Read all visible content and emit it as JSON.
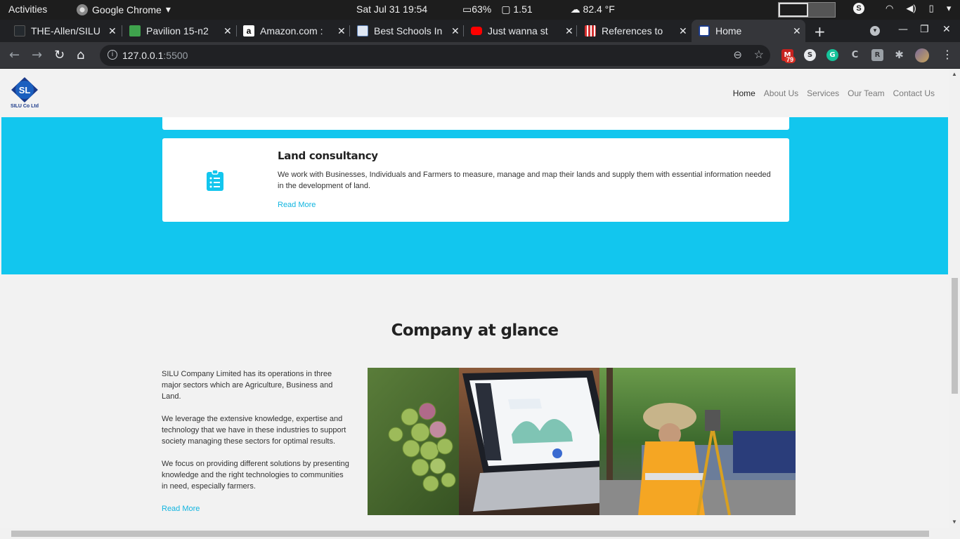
{
  "os_bar": {
    "activities": "Activities",
    "app_name": "Google Chrome",
    "clock": "Sat Jul 31  19:54",
    "battery": "63%",
    "load": "1.51",
    "weather": "82.4 °F"
  },
  "tabs": [
    {
      "title": "THE-Allen/SILU",
      "color": "#24292e",
      "active": false
    },
    {
      "title": "Pavilion 15-n2",
      "color": "#3fa34d",
      "active": false
    },
    {
      "title": "Amazon.com :",
      "color": "#f3a847",
      "active": false
    },
    {
      "title": "Best Schools In",
      "color": "#5b7fb5",
      "active": false
    },
    {
      "title": "Just wanna st",
      "color": "#ff0000",
      "active": false
    },
    {
      "title": "References to",
      "color": "#d32f2f",
      "active": false
    },
    {
      "title": "Home",
      "color": "#1b3a8a",
      "active": true
    }
  ],
  "address": {
    "host": "127.0.0.1",
    "port": ":5500"
  },
  "extensions": {
    "gmail_badge": "79"
  },
  "site": {
    "logo_text": "SILU Co Ltd",
    "logo_initials": "SL",
    "nav": [
      "Home",
      "About Us",
      "Services",
      "Our Team",
      "Contact Us"
    ],
    "nav_active": "Home",
    "service_card": {
      "title": "Land consultancy",
      "description": "We work with Businesses, Individuals and Farmers to measure, manage and map their lands and supply them with essential information needed in the development of land.",
      "link": "Read More",
      "icon": "clipboard-list-icon"
    },
    "glance": {
      "title": "Company at glance",
      "paragraphs": [
        "SILU Company Limited has its operations in three major sectors which are Agriculture, Business and Land.",
        "We leverage the extensive knowledge, expertise and technology that we have in these industries to support society managing these sectors for optimal results.",
        "We focus on providing different solutions by presenting knowledge and the right technologies to communities in need, especially farmers."
      ],
      "link": "Read More"
    },
    "colors": {
      "accent": "#12c6ee",
      "link": "#12b5e0",
      "brand": "#1b3a8a"
    }
  }
}
